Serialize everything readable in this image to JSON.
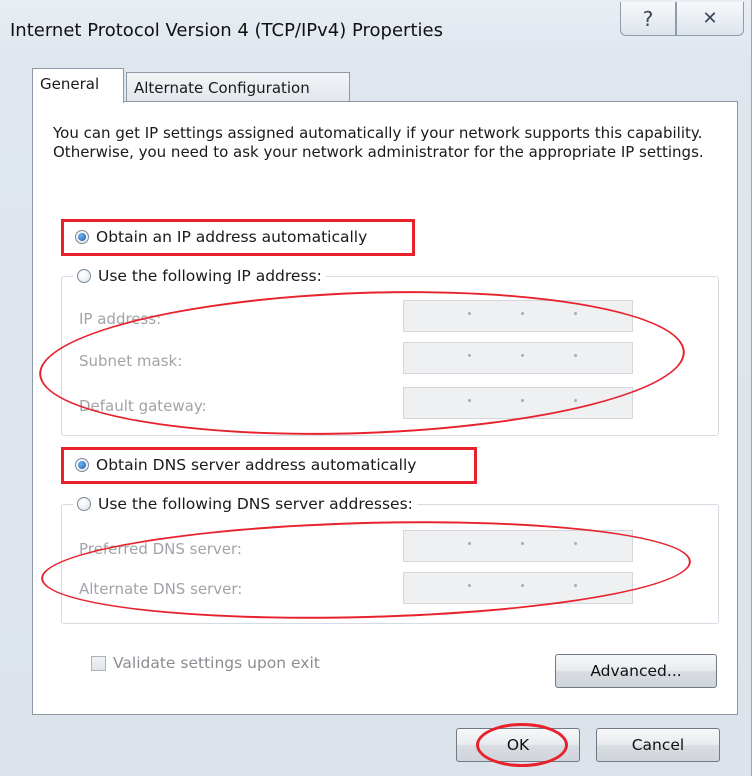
{
  "window": {
    "title": "Internet Protocol Version 4 (TCP/IPv4) Properties",
    "help_glyph": "?",
    "close_glyph": "✕"
  },
  "tabs": [
    {
      "label": "General",
      "active": true
    },
    {
      "label": "Alternate Configuration",
      "active": false
    }
  ],
  "description": "You can get IP settings assigned automatically if your network supports this capability. Otherwise, you need to ask your network administrator for the appropriate IP settings.",
  "ip_section": {
    "auto_label": "Obtain an IP address automatically",
    "manual_label": "Use the following IP address:",
    "auto_selected": true,
    "fields": [
      {
        "label": "IP address:",
        "value": ""
      },
      {
        "label": "Subnet mask:",
        "value": ""
      },
      {
        "label": "Default gateway:",
        "value": ""
      }
    ]
  },
  "dns_section": {
    "auto_label": "Obtain DNS server address automatically",
    "manual_label": "Use the following DNS server addresses:",
    "auto_selected": true,
    "fields": [
      {
        "label": "Preferred DNS server:",
        "value": ""
      },
      {
        "label": "Alternate DNS server:",
        "value": ""
      }
    ]
  },
  "validate_label": "Validate settings upon exit",
  "validate_checked": false,
  "buttons": {
    "advanced": "Advanced...",
    "ok": "OK",
    "cancel": "Cancel"
  },
  "annotation_color": "#e8222c",
  "accent_color": "#1f5fa6"
}
